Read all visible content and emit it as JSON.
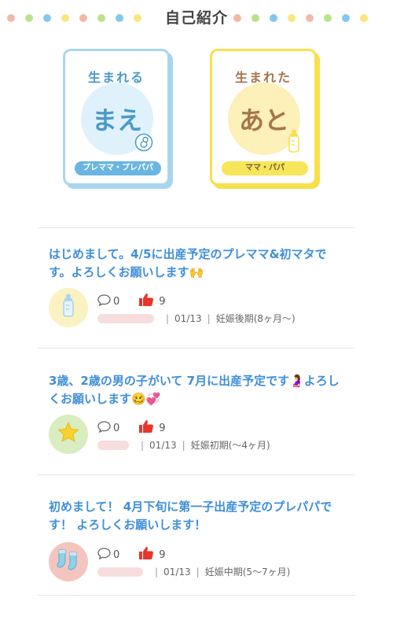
{
  "header": {
    "title": "自己紹介",
    "dot_colors": [
      "#f3b8a8",
      "#b9e38b",
      "#82c8ee",
      "#fbe57c",
      "#f3b8a8",
      "#b9e38b",
      "#82c8ee",
      "#fbe57c"
    ]
  },
  "cards": [
    {
      "top": "生まれる",
      "center": "まえ",
      "pill": "プレママ・プレパパ",
      "icon": "fetus-icon"
    },
    {
      "top": "生まれた",
      "center": "あと",
      "pill": "ママ・パパ",
      "icon": "baby-bottle-icon"
    }
  ],
  "posts": [
    {
      "title": "はじめまして。4/5に出産予定のプレママ&初マタです。よろしくお願いします🙌",
      "comments": "0",
      "likes": "9",
      "date": "01/13",
      "stage": "妊娠後期(8ヶ月〜)",
      "avatar_icon": "baby-bottle-icon",
      "avatar_color": "#fbf2c2"
    },
    {
      "title": "3歳、2歳の男の子がいて 7月に出産予定です🤰よろしくお願いします🥴💞",
      "comments": "0",
      "likes": "9",
      "date": "01/13",
      "stage": "妊娠初期(〜4ヶ月)",
      "avatar_icon": "star-icon",
      "avatar_color": "#d8edc0"
    },
    {
      "title": "初めまして！ 4月下旬に第一子出産予定のプレパパです！ よろしくお願いします！",
      "comments": "0",
      "likes": "9",
      "date": "01/13",
      "stage": "妊娠中期(5〜7ヶ月)",
      "avatar_icon": "baby-socks-icon",
      "avatar_color": "#f4c5be"
    }
  ]
}
